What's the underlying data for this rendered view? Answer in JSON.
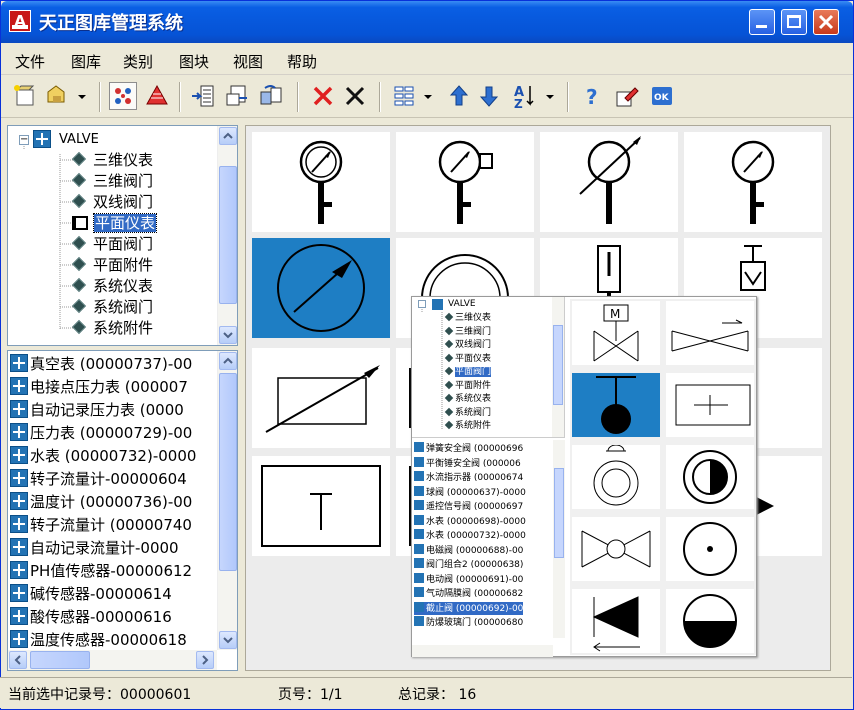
{
  "app": {
    "title": "天正图库管理系统",
    "icon_letter": "A"
  },
  "menu": [
    "文件",
    "图库",
    "类别",
    "图块",
    "视图",
    "帮助"
  ],
  "toolbar_icons": [
    "new-library-icon",
    "open-library-icon",
    "dropdown-arrow-icon",
    "display-mode-icon",
    "batch-icon",
    "import-icon",
    "export-icon",
    "replace-icon",
    "delete-red-icon",
    "delete-black-icon",
    "layout-icon",
    "dropdown-arrow-icon",
    "move-up-icon",
    "move-down-icon",
    "sort-icon",
    "dropdown-arrow-icon",
    "help-icon",
    "edit-icon",
    "ok-icon"
  ],
  "tree": {
    "root": "VALVE",
    "items": [
      "三维仪表",
      "三维阀门",
      "双线阀门",
      "平面仪表",
      "平面阀门",
      "平面附件",
      "系统仪表",
      "系统阀门",
      "系统附件"
    ],
    "selected_index": 3
  },
  "list": {
    "items": [
      "真空表 (00000737)-00",
      "电接点压力表 (000007",
      "自动记录压力表 (0000",
      "压力表 (00000729)-00",
      "水表 (00000732)-0000",
      "转子流量计-00000604",
      "温度计 (00000736)-00",
      "转子流量计 (00000740",
      "自动记录流量计-0000",
      "PH值传感器-00000612",
      "碱传感器-00000614",
      "酸传感器-00000616",
      "温度传感器-00000618"
    ]
  },
  "inset": {
    "tree_root": "VALVE",
    "tree_items": [
      "三维仪表",
      "三维阀门",
      "双线阀门",
      "平面仪表",
      "平面阀门",
      "平面附件",
      "系统仪表",
      "系统阀门",
      "系统附件"
    ],
    "tree_selected_index": 4,
    "list_items": [
      "弹簧安全阀 (00000696",
      "平衡锤安全阀 (000006",
      "水流指示器 (00000674",
      "球阀 (00000637)-0000",
      "遥控信号阀 (00000697",
      "水表 (00000698)-0000",
      "水表 (00000732)-0000",
      "电磁阀 (00000688)-00",
      "阀门组合2 (00000638)",
      "电动阀 (00000691)-00",
      "气动隔膜阀 (00000682",
      "截止阀 (00000692)-00",
      "防爆玻璃门 (00000680"
    ],
    "list_selected_index": 11,
    "cell_label_m": "M"
  },
  "status": {
    "record": "当前选中记录号：00000601",
    "page": "页号：1/1",
    "total": "总记录：  16"
  }
}
